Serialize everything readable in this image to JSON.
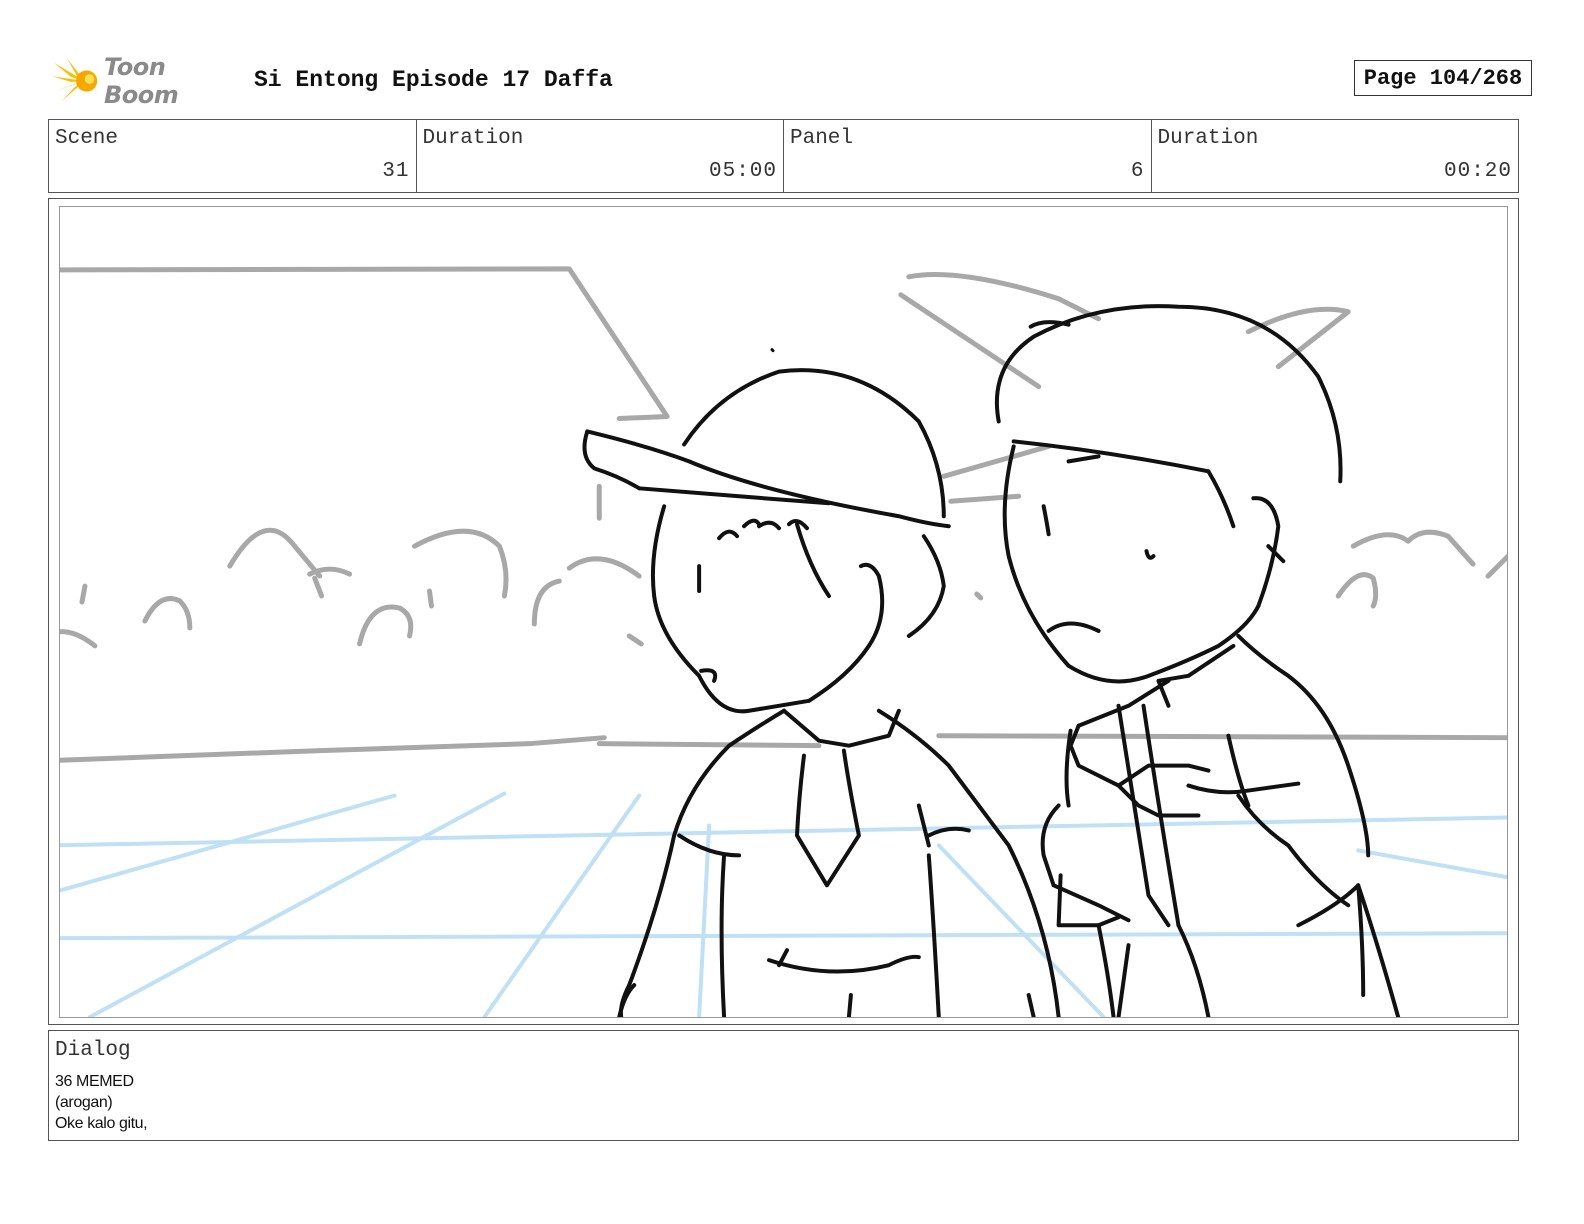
{
  "header": {
    "logo_text": "Toon Boom",
    "title": "Si Entong Episode 17 Daffa",
    "page_label": "Page 104/268"
  },
  "info": {
    "scene_label": "Scene",
    "scene_value": "31",
    "duration_label": "Duration",
    "duration_value": "05:00",
    "panel_label": "Panel",
    "panel_value": "6",
    "panel_duration_label": "Duration",
    "panel_duration_value": "00:20"
  },
  "panel": {
    "icons": [
      "sketch-background",
      "sketch-character-cap-boy",
      "sketch-character-boy-with-books"
    ],
    "colors": {
      "line": "#111111",
      "background_sketch": "#a8a8a8",
      "perspective_grid": "#bfe0f5"
    }
  },
  "dialog": {
    "label": "Dialog",
    "lines": [
      "36 MEMED",
      "(arogan)",
      "Oke kalo gitu,"
    ]
  },
  "colors": {
    "logo_accent": "#f5c20a",
    "logo_text": "#8a8a8a"
  }
}
